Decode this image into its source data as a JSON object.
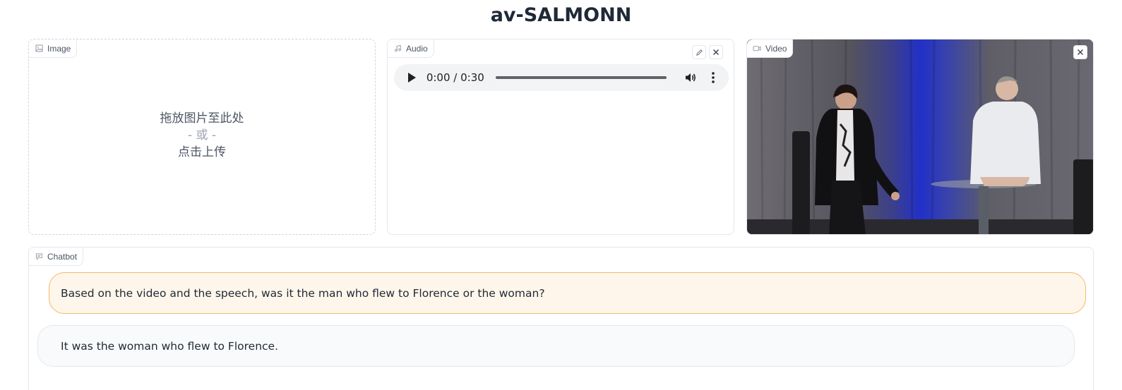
{
  "app": {
    "title": "av-SALMONN"
  },
  "image_panel": {
    "label": "Image",
    "icon": "image-icon",
    "drop_text": "拖放图片至此处",
    "or_text": "- 或 -",
    "click_text": "点击上传"
  },
  "audio_panel": {
    "label": "Audio",
    "icon": "music-icon",
    "time_display": "0:00 / 0:30",
    "progress": 0
  },
  "video_panel": {
    "label": "Video",
    "icon": "video-camera-icon"
  },
  "chatbot": {
    "label": "Chatbot",
    "icon": "chat-icon",
    "messages": [
      {
        "role": "user",
        "text": "Based on the video and the speech, was it the man who flew to Florence or the woman?"
      },
      {
        "role": "bot",
        "text": "It was the woman who flew to Florence."
      }
    ]
  },
  "colors": {
    "user_bubble_bg": "#fef6ea",
    "user_bubble_border": "#f3b96b",
    "bot_bubble_bg": "#f9fafb"
  }
}
